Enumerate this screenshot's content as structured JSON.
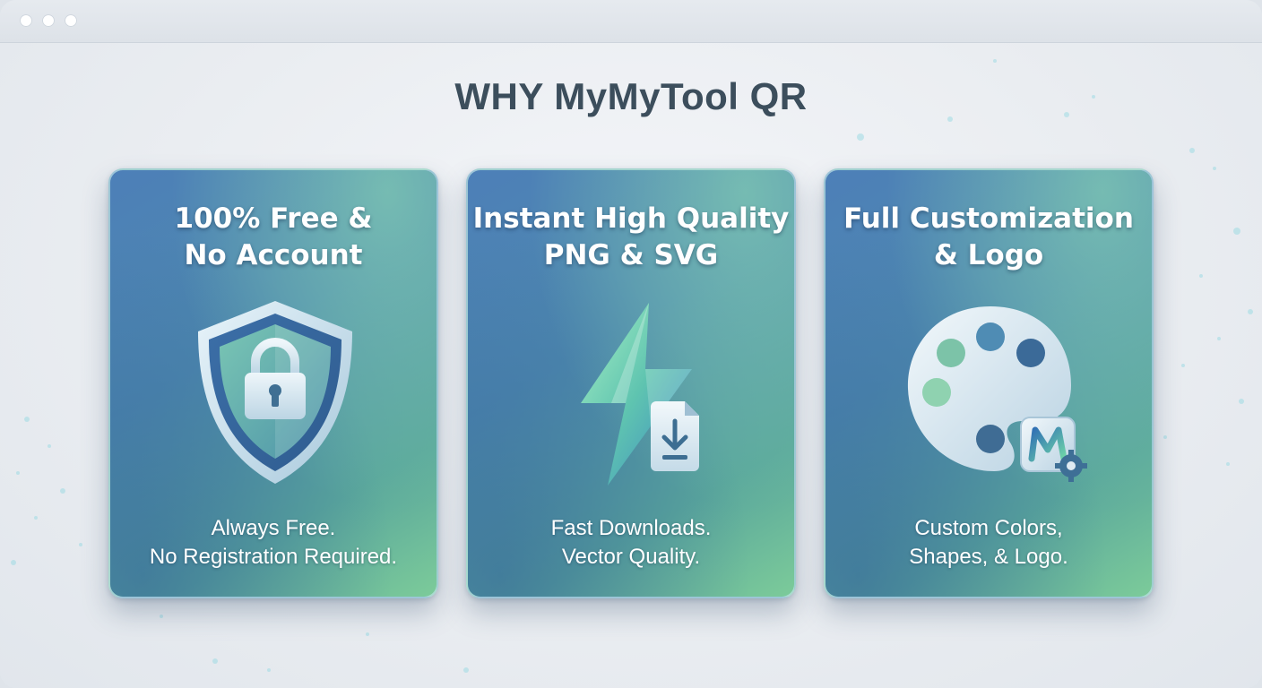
{
  "window": {
    "controls": [
      "window-dot",
      "window-dot",
      "window-dot"
    ]
  },
  "heading": "WHY MyMyTool QR",
  "cards": [
    {
      "title": "100% Free &\nNo Account",
      "icon": "shield-lock-icon",
      "description": "Always Free.\nNo Registration Required."
    },
    {
      "title": "Instant High Quality\nPNG & SVG",
      "icon": "lightning-download-icon",
      "description": "Fast Downloads.\nVector Quality."
    },
    {
      "title": "Full Customization\n& Logo",
      "icon": "palette-logo-icon",
      "description": "Custom Colors,\nShapes, & Logo."
    }
  ],
  "colors": {
    "card_gradient_start": "#4d7fb8",
    "card_gradient_end": "#7ccb9a",
    "heading": "#3c4e5c",
    "background": "#eaedf1"
  }
}
